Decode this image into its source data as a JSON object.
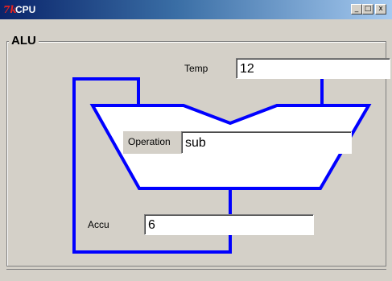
{
  "window": {
    "title": "CPU",
    "icon": "tk-feather-icon",
    "icon_glyph": "7k",
    "buttons": {
      "minimize": "_",
      "maximize": "□",
      "close": "x"
    }
  },
  "alu": {
    "group_label": "ALU",
    "temp": {
      "label": "Temp",
      "value": "12"
    },
    "operation": {
      "label": "Operation",
      "value": "sub"
    },
    "accu": {
      "label": "Accu",
      "value": "6"
    }
  },
  "colors": {
    "wire": "#0000ff",
    "background": "#d4d0c8",
    "title_gradient_start": "#0a246a",
    "title_gradient_end": "#a6caf0"
  }
}
